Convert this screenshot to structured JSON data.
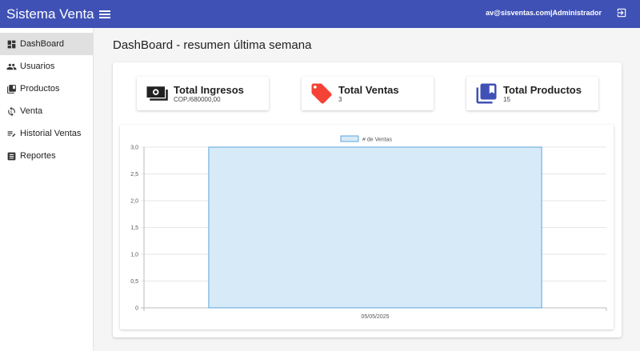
{
  "header": {
    "app_title": "Sistema Venta",
    "user": "av@sisventas.com|Administrador"
  },
  "sidebar": {
    "items": [
      {
        "label": "DashBoard",
        "icon": "dashboard-icon",
        "active": true
      },
      {
        "label": "Usuarios",
        "icon": "users-icon"
      },
      {
        "label": "Productos",
        "icon": "products-icon"
      },
      {
        "label": "Venta",
        "icon": "sale-icon"
      },
      {
        "label": "Historial Ventas",
        "icon": "history-icon"
      },
      {
        "label": "Reportes",
        "icon": "reports-icon"
      }
    ]
  },
  "main": {
    "title": "DashBoard - resumen última semana",
    "cards": [
      {
        "title": "Total Ingresos",
        "value": "COP./680000,00",
        "icon": "money-icon",
        "color": "#212121"
      },
      {
        "title": "Total Ventas",
        "value": "3",
        "icon": "tag-icon",
        "color": "#f44336"
      },
      {
        "title": "Total Productos",
        "value": "15",
        "icon": "library-icon",
        "color": "#3f51b5"
      }
    ]
  },
  "colors": {
    "primary": "#3f51b5",
    "bar_fill": "#d6eaf8",
    "bar_stroke": "#5da5da"
  },
  "chart_data": {
    "type": "bar",
    "categories": [
      "05/05/2025"
    ],
    "series": [
      {
        "name": "# de Ventas",
        "values": [
          3
        ]
      }
    ],
    "ylim": [
      0,
      3
    ],
    "yticks": [
      "0",
      "0,5",
      "1,0",
      "1,5",
      "2,0",
      "2,5",
      "3,0"
    ],
    "legend": "top-center",
    "grid": true
  }
}
